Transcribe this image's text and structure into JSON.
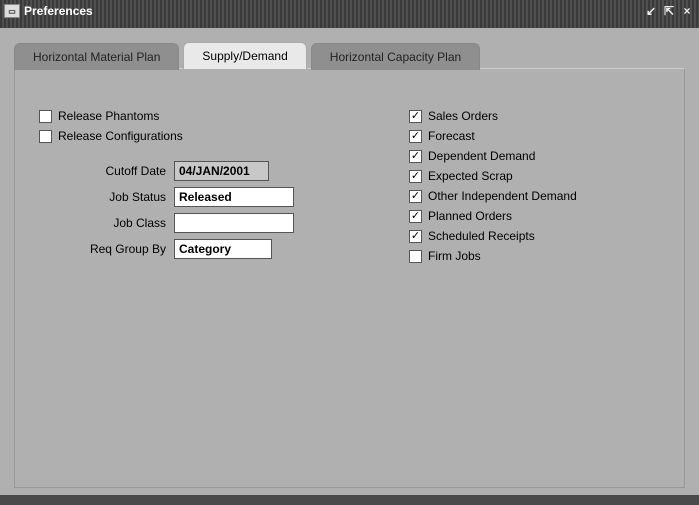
{
  "window": {
    "title": "Preferences"
  },
  "tabs": {
    "material_plan": "Horizontal Material Plan",
    "supply_demand": "Supply/Demand",
    "capacity_plan": "Horizontal Capacity Plan"
  },
  "left": {
    "release_phantoms": {
      "label": "Release Phantoms",
      "checked": false
    },
    "release_configs": {
      "label": "Release Configurations",
      "checked": false
    },
    "cutoff_date": {
      "label": "Cutoff Date",
      "value": "04/JAN/2001"
    },
    "job_status": {
      "label": "Job Status",
      "value": "Released"
    },
    "job_class": {
      "label": "Job Class",
      "value": ""
    },
    "req_group_by": {
      "label": "Req Group By",
      "value": "Category"
    }
  },
  "right": {
    "sales_orders": {
      "label": "Sales Orders",
      "checked": true
    },
    "forecast": {
      "label": "Forecast",
      "checked": true
    },
    "dependent_demand": {
      "label": "Dependent Demand",
      "checked": true
    },
    "expected_scrap": {
      "label": "Expected Scrap",
      "checked": true
    },
    "other_independent": {
      "label": "Other Independent Demand",
      "checked": true
    },
    "planned_orders": {
      "label": "Planned Orders",
      "checked": true
    },
    "scheduled_receipts": {
      "label": "Scheduled Receipts",
      "checked": true
    },
    "firm_jobs": {
      "label": "Firm Jobs",
      "checked": false
    }
  }
}
